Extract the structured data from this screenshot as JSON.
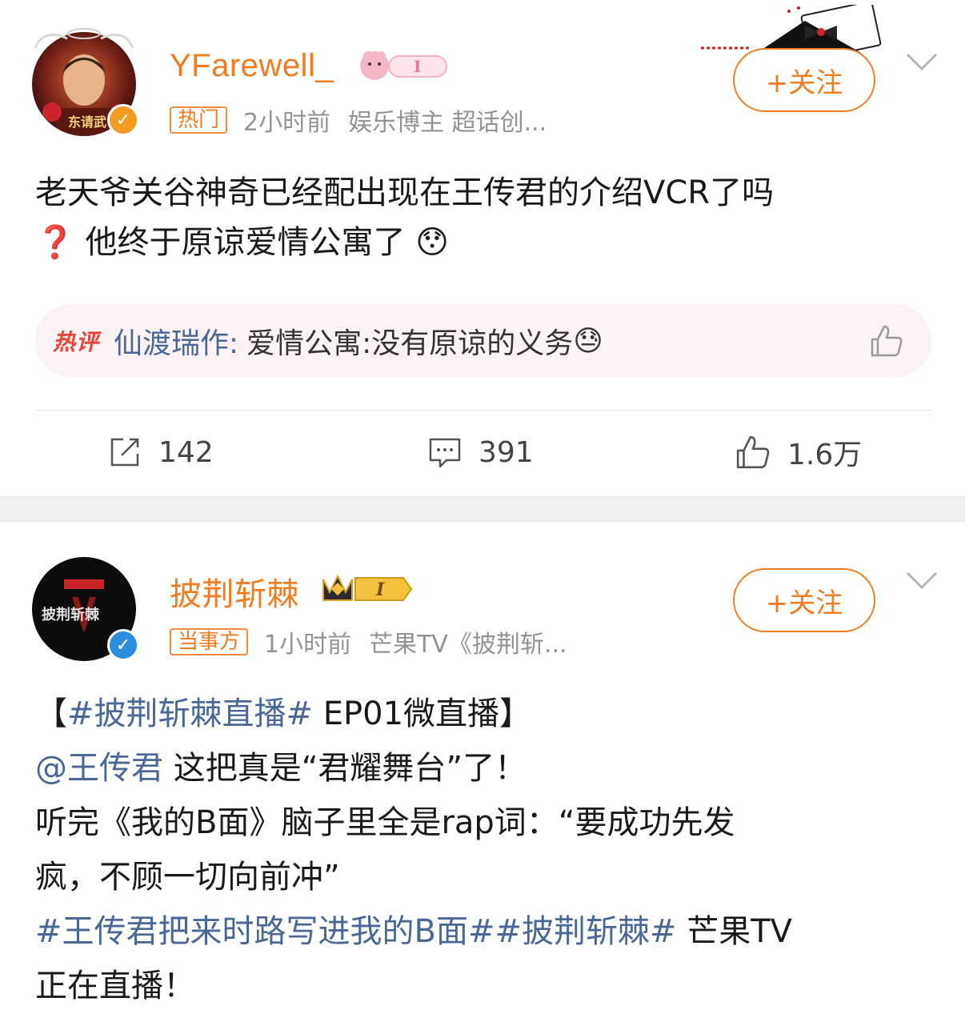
{
  "posts": [
    {
      "username": "YFarewell_",
      "tag": "热门",
      "time": "2小时前",
      "source": "娱乐博主 超话创...",
      "follow_label": "+关注",
      "content_line1": "老天爷关谷神奇已经配出现在王传君的介绍VCR了吗",
      "content_line2_icon": "❓",
      "content_line2": "他终于原谅爱情公寓了",
      "content_line2_emoji": "😯",
      "hot_comment": {
        "label": "热评",
        "user": "仙渡瑞作:",
        "text": "爱情公寓:没有原谅的义务",
        "emoji": "😓"
      },
      "actions": {
        "repost": "142",
        "comment": "391",
        "like": "1.6万"
      },
      "avatar_label": "东请武"
    },
    {
      "username": "披荆斩棘",
      "badge_letter": "I",
      "tag": "当事方",
      "time": "1小时前",
      "source": "芒果TV《披荆斩...",
      "follow_label": "+关注",
      "avatar_label": "披荆斩棘",
      "content": {
        "l1_open": "【",
        "l1_topic": "#披荆斩棘直播#",
        "l1_rest": " EP01微直播】",
        "l2_mention": "@王传君",
        "l2_rest": " 这把真是“君耀舞台”了！",
        "l3": "听完《我的B面》脑子里全是rap词：“要成功先发",
        "l4": "疯，不顾一切向前冲”",
        "l5_topic1": "#王传君把来时路写进我的B面#",
        "l5_topic2": "#披荆斩棘#",
        "l5_rest": " 芒果TV",
        "l6": "正在直播！"
      }
    }
  ],
  "colors": {
    "accent_orange": "#f07d22",
    "link_blue": "#4a6796",
    "hot_red": "#e8433a"
  }
}
